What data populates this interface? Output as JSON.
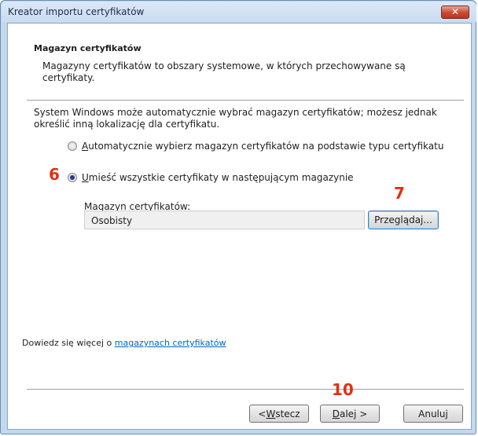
{
  "window": {
    "title": "Kreator importu certyfikatów",
    "close_glyph": "✕"
  },
  "header": {
    "title": "Magazyn certyfikatów",
    "description": "Magazyny certyfikatów to obszary systemowe, w których przechowywane są certyfikaty."
  },
  "body": {
    "intro": "System Windows może automatycznie wybrać magazyn certyfikatów; możesz jednak określić inną lokalizację dla certyfikatu.",
    "option_auto": {
      "mnemonic": "A",
      "rest": "utomatycznie wybierz magazyn certyfikatów na podstawie typu certyfikatu",
      "selected": false
    },
    "option_manual": {
      "mnemonic": "U",
      "rest": "mieść wszystkie certyfikaty w następującym magazynie",
      "selected": true
    },
    "store_label": "Magazyn certyfikatów:",
    "store_value": "Osobisty",
    "browse_label": "Przeglądaj..."
  },
  "footer": {
    "more_info_prefix": "Dowiedz się więcej o ",
    "more_info_link": "magazynach certyfikatów",
    "back": {
      "prefix": "< ",
      "mnemonic": "W",
      "rest": "stecz"
    },
    "next": {
      "mnemonic": "D",
      "rest": "alej >"
    },
    "cancel": "Anuluj"
  },
  "annotations": {
    "step6": "6",
    "step7": "7",
    "step10": "10",
    "color": "#e23012"
  },
  "colors": {
    "frame": "#c4d8ee",
    "link": "#0066cc",
    "close": "#c74a34"
  }
}
